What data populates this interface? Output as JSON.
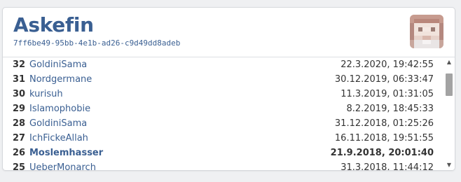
{
  "profile": {
    "name": "Askefin",
    "uuid": "7ff6be49-95bb-4e1b-ad26-c9d49dd8adeb"
  },
  "history": [
    {
      "rank": "32",
      "name": "GoldiniSama",
      "date": "22.3.2020, 19:42:55"
    },
    {
      "rank": "31",
      "name": "Nordgermane",
      "date": "30.12.2019, 06:33:47"
    },
    {
      "rank": "30",
      "name": "kurisuh",
      "date": "11.3.2019, 01:31:05"
    },
    {
      "rank": "29",
      "name": "Islamophobie",
      "date": "8.2.2019, 18:45:33"
    },
    {
      "rank": "28",
      "name": "GoldiniSama",
      "date": "31.12.2018, 01:25:26"
    },
    {
      "rank": "27",
      "name": "IchFickeAllah",
      "date": "16.11.2018, 19:51:55"
    },
    {
      "rank": "26",
      "name": "Moslemhasser",
      "date": "21.9.2018, 20:01:40",
      "current": true
    },
    {
      "rank": "25",
      "name": "UeberMonarch",
      "date": "31.3.2018, 11:44:12"
    }
  ],
  "scrollbar": {
    "up_icon": "▲",
    "down_icon": "▼",
    "position_fraction": 0.05
  }
}
